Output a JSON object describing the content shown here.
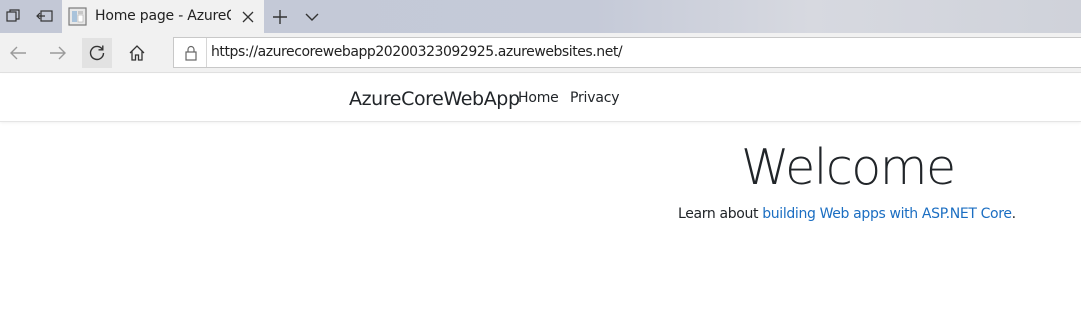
{
  "browser": {
    "tab": {
      "title": "Home page - AzureCore"
    },
    "address": {
      "url": "https://azurecorewebapp20200323092925.azurewebsites.net/"
    },
    "icons": {
      "set_aside_tabs": "tabs-aside-icon",
      "restore_tabs": "tabs-restore-icon",
      "favicon": "page-favicon-icon",
      "close_tab": "close-icon",
      "new_tab": "plus-icon",
      "tab_list": "chevron-down-icon",
      "back": "back-arrow-icon",
      "forward": "forward-arrow-icon",
      "refresh": "refresh-icon",
      "home": "home-icon",
      "lock": "lock-icon"
    }
  },
  "site": {
    "brand": "AzureCoreWebApp",
    "nav": [
      {
        "label": "Home"
      },
      {
        "label": "Privacy"
      }
    ],
    "main": {
      "heading": "Welcome",
      "lead_prefix": "Learn about ",
      "lead_link": "building Web apps with ASP.NET Core",
      "lead_suffix": "."
    }
  },
  "colors": {
    "link": "#1b6ec2",
    "text": "#212529"
  }
}
